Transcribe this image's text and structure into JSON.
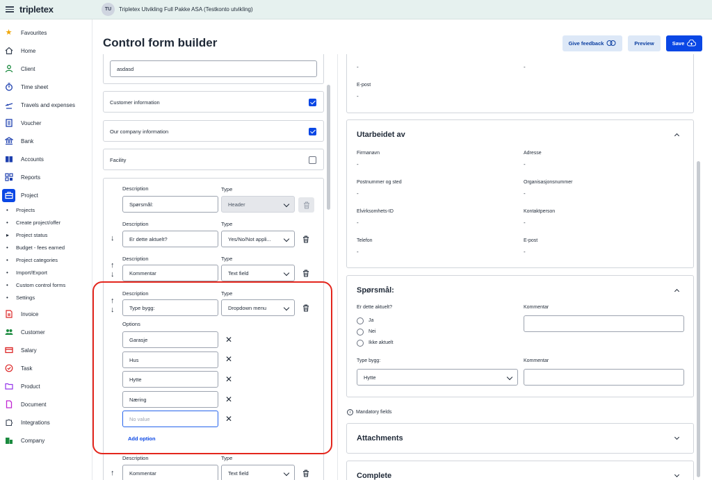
{
  "topbar": {
    "logo": "tripletex",
    "avatar_initials": "TU",
    "company": "Tripletex Utvikling Full Pakke ASA (Testkonto utvikling)"
  },
  "sidebar": {
    "items": [
      {
        "label": "Favourites",
        "icon": "star-icon"
      },
      {
        "label": "Home",
        "icon": "home-icon"
      },
      {
        "label": "Client",
        "icon": "client-icon"
      },
      {
        "label": "Time sheet",
        "icon": "stopwatch-icon"
      },
      {
        "label": "Travels and expenses",
        "icon": "plane-icon"
      },
      {
        "label": "Voucher",
        "icon": "voucher-icon"
      },
      {
        "label": "Bank",
        "icon": "bank-icon"
      },
      {
        "label": "Accounts",
        "icon": "book-icon"
      },
      {
        "label": "Reports",
        "icon": "reports-icon"
      },
      {
        "label": "Project",
        "icon": "briefcase-icon"
      }
    ],
    "subitems": [
      {
        "label": "Projects",
        "bullet": "•"
      },
      {
        "label": "Create project/offer",
        "bullet": "•"
      },
      {
        "label": "Project status",
        "bullet": "▸"
      },
      {
        "label": "Budget - fees earned",
        "bullet": "•"
      },
      {
        "label": "Project categories",
        "bullet": "•"
      },
      {
        "label": "Import/Export",
        "bullet": "•"
      },
      {
        "label": "Custom control forms",
        "bullet": "•"
      },
      {
        "label": "Settings",
        "bullet": "•"
      }
    ],
    "items2": [
      {
        "label": "Invoice",
        "icon": "invoice-icon"
      },
      {
        "label": "Customer",
        "icon": "customer-icon"
      },
      {
        "label": "Salary",
        "icon": "salary-icon"
      },
      {
        "label": "Task",
        "icon": "task-icon"
      },
      {
        "label": "Product",
        "icon": "folder-icon"
      },
      {
        "label": "Document",
        "icon": "document-icon"
      },
      {
        "label": "Integrations",
        "icon": "puzzle-icon"
      },
      {
        "label": "Company",
        "icon": "company-icon"
      }
    ]
  },
  "header": {
    "title": "Control form builder",
    "feedback": "Give feedback",
    "preview": "Preview",
    "save": "Save"
  },
  "builder": {
    "name_value": "asdasd",
    "toggles": [
      {
        "label": "Customer information",
        "checked": true
      },
      {
        "label": "Our company information",
        "checked": true
      },
      {
        "label": "Facility",
        "checked": false
      }
    ],
    "desc_label": "Description",
    "type_label": "Type",
    "rows": [
      {
        "desc": "Spørsmål:",
        "type": "Header"
      },
      {
        "desc": "Er dette aktuelt?",
        "type": "Yes/No/Not appli..."
      },
      {
        "desc": "Kommentar",
        "type": "Text field"
      },
      {
        "desc": "Type bygg:",
        "type": "Dropdown menu"
      },
      {
        "desc": "Kommentar",
        "type": "Text field"
      }
    ],
    "options_label": "Options",
    "options": [
      "Garasje",
      "Hus",
      "Hytte",
      "Næring"
    ],
    "new_option_placeholder": "No value",
    "add_option": "Add option"
  },
  "preview": {
    "top_dash1": "-",
    "top_dash2": "-",
    "top_epost": "E-post",
    "top_dash3": "-",
    "utarbeidet": {
      "title": "Utarbeidet av",
      "fields": [
        {
          "label": "Firmanavn",
          "value": "-"
        },
        {
          "label": "Adresse",
          "value": "-"
        },
        {
          "label": "Postnummer og sted",
          "value": "-"
        },
        {
          "label": "Organisasjonsnummer",
          "value": "-"
        },
        {
          "label": "Elvirksomhets-ID",
          "value": "-"
        },
        {
          "label": "Kontaktperson",
          "value": "-"
        },
        {
          "label": "Telefon",
          "value": "-"
        },
        {
          "label": "E-post",
          "value": "-"
        }
      ]
    },
    "sporsmal": {
      "title": "Spørsmål:",
      "question": "Er dette aktuelt?",
      "radios": [
        "Ja",
        "Nei",
        "Ikke aktuelt"
      ],
      "kommentar1": "Kommentar",
      "type_bygg": "Type bygg:",
      "type_bygg_value": "Hytte",
      "kommentar2": "Kommentar"
    },
    "mandatory": "Mandatory fields",
    "attachments": "Attachments",
    "complete": "Complete"
  }
}
